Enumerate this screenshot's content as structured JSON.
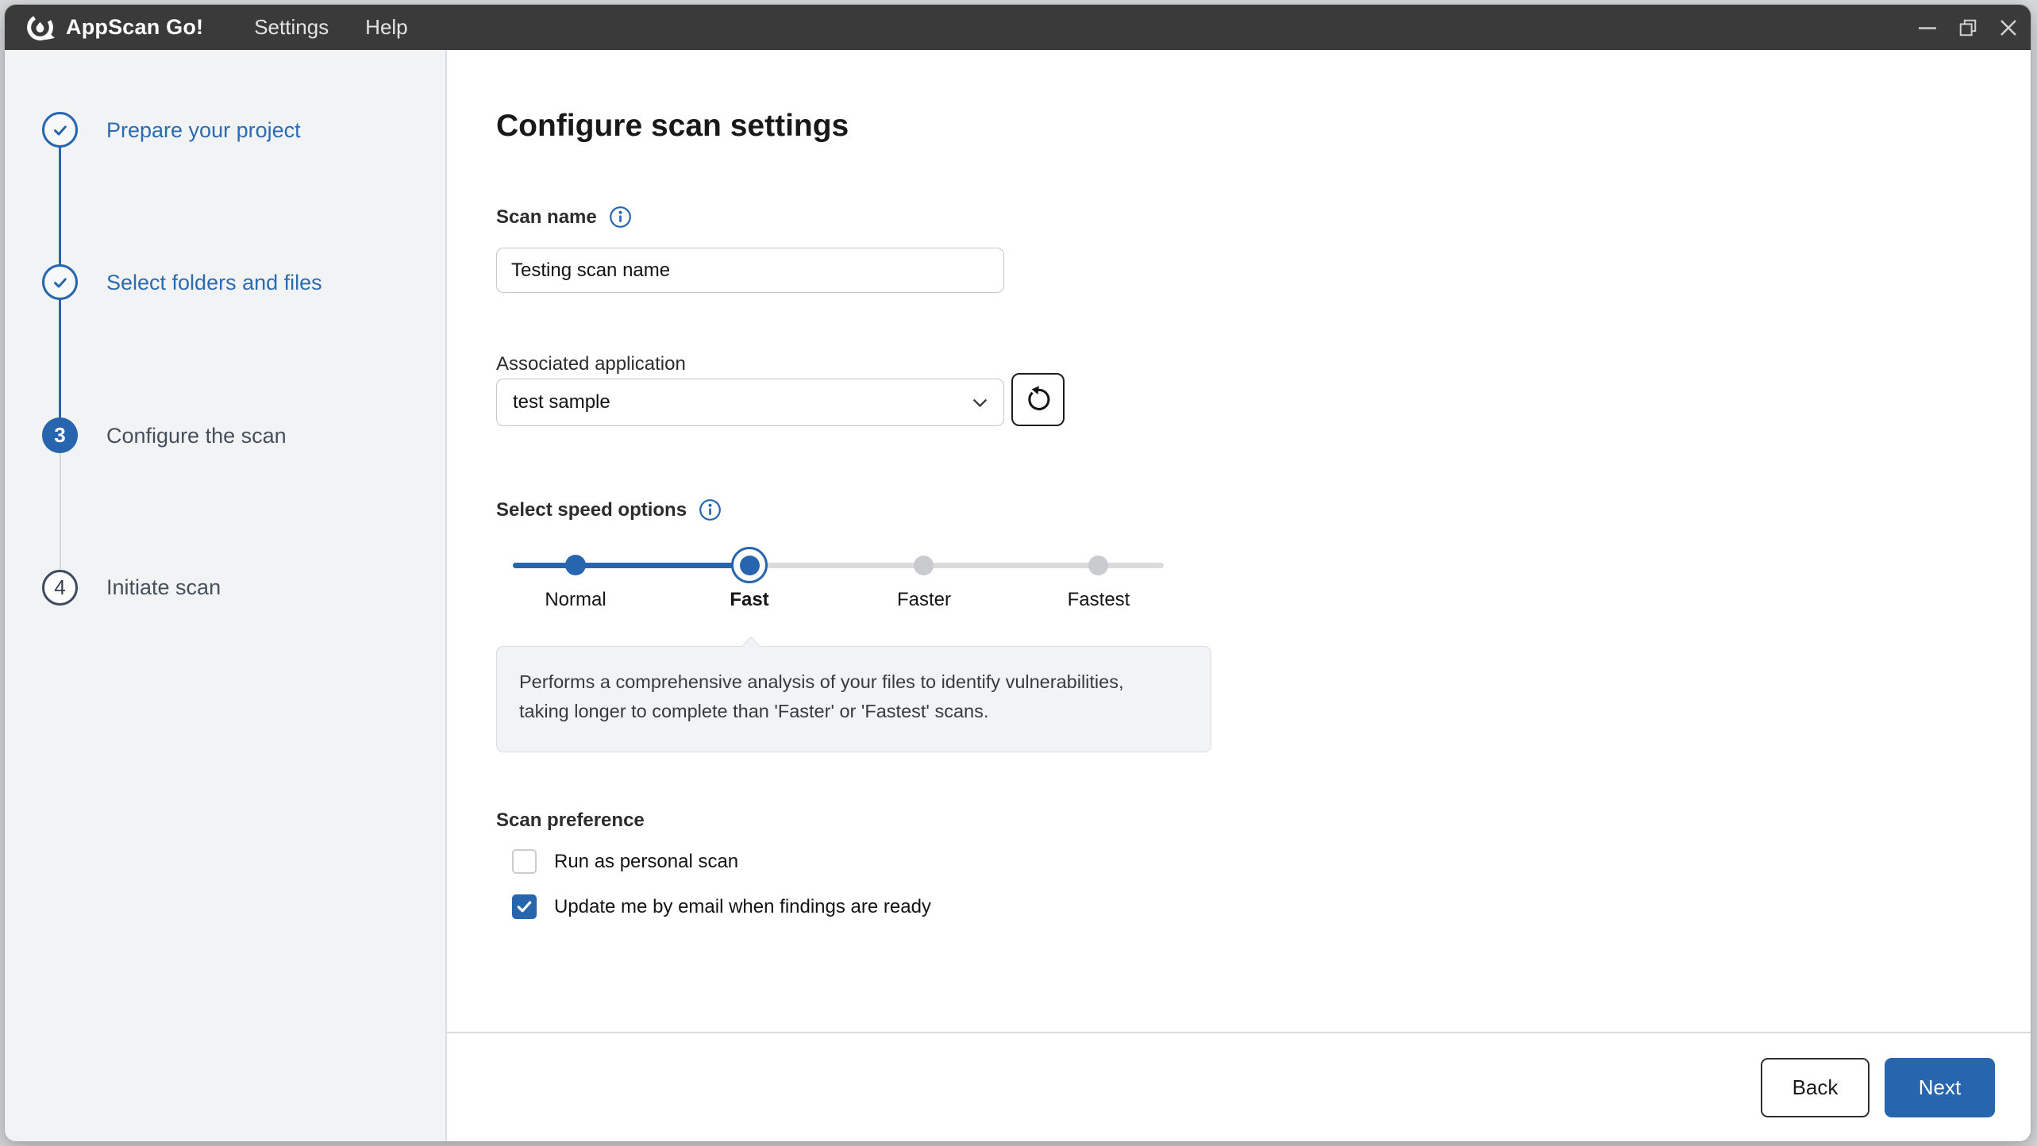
{
  "colors": {
    "accent": "#2766ae",
    "titlebar": "#3a3a3a",
    "sidebar_bg": "#f2f3f5"
  },
  "window": {
    "app_title": "AppScan Go!",
    "menu": {
      "settings": "Settings",
      "help": "Help"
    }
  },
  "stepper": {
    "steps": [
      {
        "label": "Prepare your project",
        "state": "complete"
      },
      {
        "label": "Select folders and files",
        "state": "complete"
      },
      {
        "label": "Configure the scan",
        "state": "current",
        "number": "3"
      },
      {
        "label": "Initiate scan",
        "state": "upcoming",
        "number": "4"
      }
    ]
  },
  "main": {
    "title": "Configure scan settings",
    "scan_name": {
      "label": "Scan name",
      "value": "Testing scan name"
    },
    "associated_application": {
      "label": "Associated application",
      "selected": "test sample"
    },
    "speed": {
      "label": "Select speed options",
      "options": [
        "Normal",
        "Fast",
        "Faster",
        "Fastest"
      ],
      "selected": "Fast",
      "tooltip": "Performs a comprehensive analysis of your files to identify vulnerabilities,\ntaking longer to complete than 'Faster' or 'Fastest' scans."
    },
    "scan_preference": {
      "label": "Scan preference",
      "options": [
        {
          "label": "Run as personal scan",
          "checked": false
        },
        {
          "label": "Update me by email when findings are ready",
          "checked": true
        }
      ]
    }
  },
  "footer": {
    "back_label": "Back",
    "next_label": "Next"
  }
}
